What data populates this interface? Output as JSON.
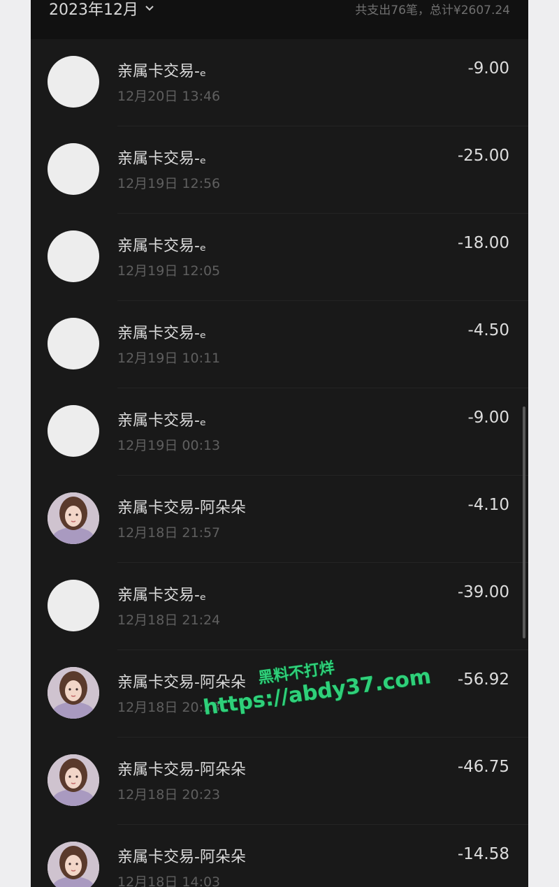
{
  "header": {
    "month_label": "2023年12月",
    "summary": "共支出76笔，总计¥2607.24"
  },
  "transactions": [
    {
      "title": "亲属卡交易-ₑ",
      "time": "12月20日 13:46",
      "amount": "-9.00",
      "avatar": "blank"
    },
    {
      "title": "亲属卡交易-ₑ",
      "time": "12月19日 12:56",
      "amount": "-25.00",
      "avatar": "blank"
    },
    {
      "title": "亲属卡交易-ₑ",
      "time": "12月19日 12:05",
      "amount": "-18.00",
      "avatar": "blank"
    },
    {
      "title": "亲属卡交易-ₑ",
      "time": "12月19日 10:11",
      "amount": "-4.50",
      "avatar": "blank"
    },
    {
      "title": "亲属卡交易-ₑ",
      "time": "12月19日 00:13",
      "amount": "-9.00",
      "avatar": "blank"
    },
    {
      "title": "亲属卡交易-阿朵朵",
      "time": "12月18日 21:57",
      "amount": "-4.10",
      "avatar": "photo"
    },
    {
      "title": "亲属卡交易-ₑ",
      "time": "12月18日 21:24",
      "amount": "-39.00",
      "avatar": "blank"
    },
    {
      "title": "亲属卡交易-阿朵朵",
      "time": "12月18日 20:23",
      "amount": "-56.92",
      "avatar": "photo"
    },
    {
      "title": "亲属卡交易-阿朵朵",
      "time": "12月18日 20:23",
      "amount": "-46.75",
      "avatar": "photo"
    },
    {
      "title": "亲属卡交易-阿朵朵",
      "time": "12月18日 14:03",
      "amount": "-14.58",
      "avatar": "photo"
    }
  ],
  "watermark": {
    "line1": "黑料不打烊",
    "line2": "https://abdy37.com"
  },
  "colors": {
    "background": "#191919",
    "header_background": "#111111",
    "watermark": "#2fd07a"
  }
}
